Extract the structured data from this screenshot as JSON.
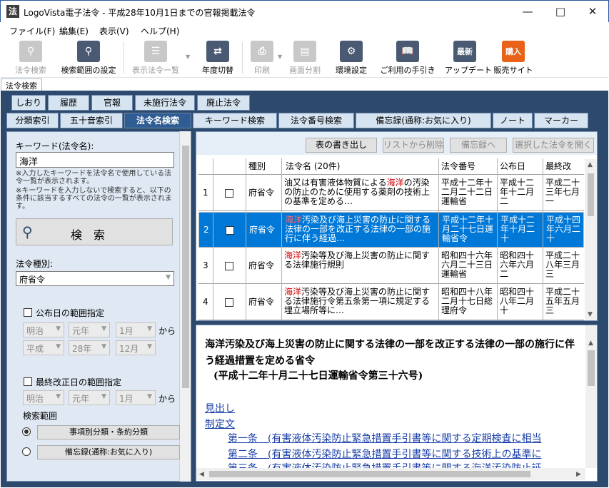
{
  "window": {
    "title": "LogoVista電子法令 - 平成28年10月1日までの官報掲載法令",
    "icon_glyph": "法"
  },
  "menu": [
    "ファイル(F)",
    "編集(E)",
    "表示(V)",
    "ヘルプ(H)"
  ],
  "toolbar": [
    {
      "label": "法令検索",
      "enabled": false,
      "icon": "magnifier-icon"
    },
    {
      "label": "検索範囲の設定",
      "enabled": true,
      "icon": "search-scope-icon"
    },
    {
      "label": "表示法令一覧",
      "enabled": false,
      "icon": "list-icon"
    },
    {
      "label": "年度切替",
      "enabled": true,
      "icon": "swap-arrows-icon"
    },
    {
      "label": "印刷",
      "enabled": false,
      "icon": "printer-icon"
    },
    {
      "label": "画面分割",
      "enabled": false,
      "icon": "split-view-icon"
    },
    {
      "label": "環境設定",
      "enabled": true,
      "icon": "gear-icon"
    },
    {
      "label": "ご利用の手引き",
      "enabled": true,
      "icon": "book-icon"
    },
    {
      "label": "アップデート",
      "enabled": true,
      "icon": "update-icon",
      "glyph": "最新"
    },
    {
      "label": "販売サイト",
      "enabled": true,
      "icon": "shop-icon",
      "glyph": "購入"
    }
  ],
  "doc_tab": "法令検索",
  "tabs_row1": [
    "しおり",
    "履歴",
    "官報",
    "未施行法令",
    "廃止法令"
  ],
  "tabs_row2": [
    "分類索引",
    "五十音索引",
    "法令名検索",
    "キーワード検索",
    "法令番号検索",
    "備忘録(通称:お気に入り)",
    "ノート",
    "マーカー"
  ],
  "left": {
    "keyword_label": "キーワード(法令名):",
    "keyword_value": "海洋",
    "note1": "※入力したキーワードを法令名で使用している法令一覧が表示されます。",
    "note2": "※キーワードを入力しないで検索すると、以下の条件に該当するすべての法令の一覧が表示されます。",
    "search_button": "検　索",
    "type_label": "法令種別:",
    "type_value": "府省令",
    "pub_range_label": "公布日の範囲指定",
    "era1": "明治",
    "year1": "元年",
    "month1": "1月",
    "kara": "から",
    "era2": "平成",
    "year2": "28年",
    "month2": "12月",
    "rev_range_label": "最終改正日の範囲指定",
    "rev_era": "明治",
    "rev_year": "元年",
    "rev_month": "1月",
    "scope_label": "検索範囲",
    "scope_opt1": "事項別分類・条約分類",
    "scope_opt2": "備忘録(通称:お気に入り)"
  },
  "right_buttons": [
    "表の書き出し",
    "リストから削除",
    "備忘録へ",
    "選択した法令を開く"
  ],
  "table": {
    "headers": [
      "",
      "",
      "種別",
      "法令名 (20件)",
      "法令番号",
      "公布日",
      "最終改"
    ],
    "rows": [
      {
        "no": "1",
        "type": "府省令",
        "hl": "海洋",
        "pre": "油又は有害液体物質による",
        "post": "の汚染の防止のために使用する薬剤の技術上の基準を定める…",
        "number": "平成十二年十二月二十二日運輸省",
        "date": "平成十二年十二月二",
        "last": "平成二十三年七月一"
      },
      {
        "no": "2",
        "type": "府省令",
        "hl": "海洋",
        "pre": "",
        "post": "汚染及び海上災害の防止に関する法律の一部を改正する法律の一部の施行に伴う経過…",
        "number": "平成十二年十月二十七日運輸省令",
        "date": "平成十二年十月二十",
        "last": "平成十四年六月二十"
      },
      {
        "no": "3",
        "type": "府省令",
        "hl": "海洋",
        "pre": "",
        "post": "汚染等及び海上災害の防止に関する法律施行規則",
        "number": "昭和四十六年六月二十三日運輸省",
        "date": "昭和四十六年六月二",
        "last": "平成二十八年三月三"
      },
      {
        "no": "4",
        "type": "府省令",
        "hl": "海洋",
        "pre": "",
        "post": "汚染等及び海上災害の防止に関する法律施行令第五条第一項に規定する埋立場所等に…",
        "number": "昭和四十八年二月十七日総理府令",
        "date": "昭和四十八年二月十",
        "last": "平成二十五年五月三"
      }
    ]
  },
  "document": {
    "title": "海洋汚染及び海上災害の防止に関する法律の一部を改正する法律の一部の施行に伴う経過措置を定める省令",
    "subtitle": "(平成十二年十月二十七日運輸省令第三十六号)",
    "link_midashi": "見出し",
    "link_seitei": "制定文",
    "articles": [
      "第一条　(有害液体汚染防止緊急措置手引書等に関する定期検査に相当",
      "第二条　(有害液体汚染防止緊急措置手引書等に関する技術上の基準に",
      "第三条　(有害液体汚染防止緊急措置手引書等に関する海洋汚染防止証"
    ]
  }
}
